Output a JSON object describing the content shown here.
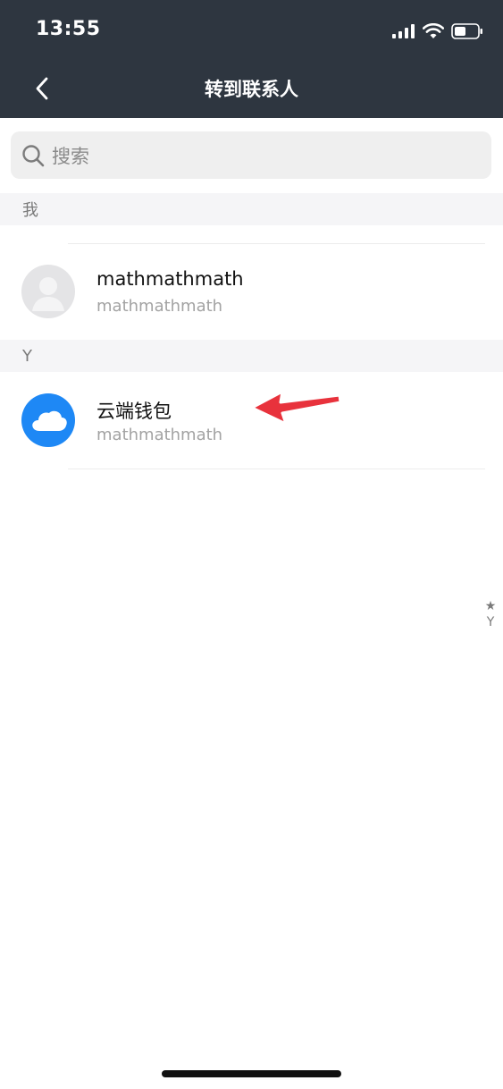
{
  "status_bar": {
    "time": "13:55"
  },
  "nav": {
    "title": "转到联系人"
  },
  "search": {
    "placeholder": "搜索"
  },
  "sections": [
    {
      "label": "我",
      "contacts": [
        {
          "name": "mathmathmath",
          "subtitle": "mathmathmath",
          "avatar": "default-person"
        }
      ]
    },
    {
      "label": "Y",
      "contacts": [
        {
          "name": "云端钱包",
          "subtitle": "mathmathmath",
          "avatar": "cloud-blue"
        }
      ]
    }
  ],
  "index_bar": {
    "items": [
      "★",
      "Y"
    ]
  },
  "colors": {
    "header_bg": "#2e3640",
    "cloud_avatar": "#1e88f5",
    "arrow": "#e8323c"
  }
}
